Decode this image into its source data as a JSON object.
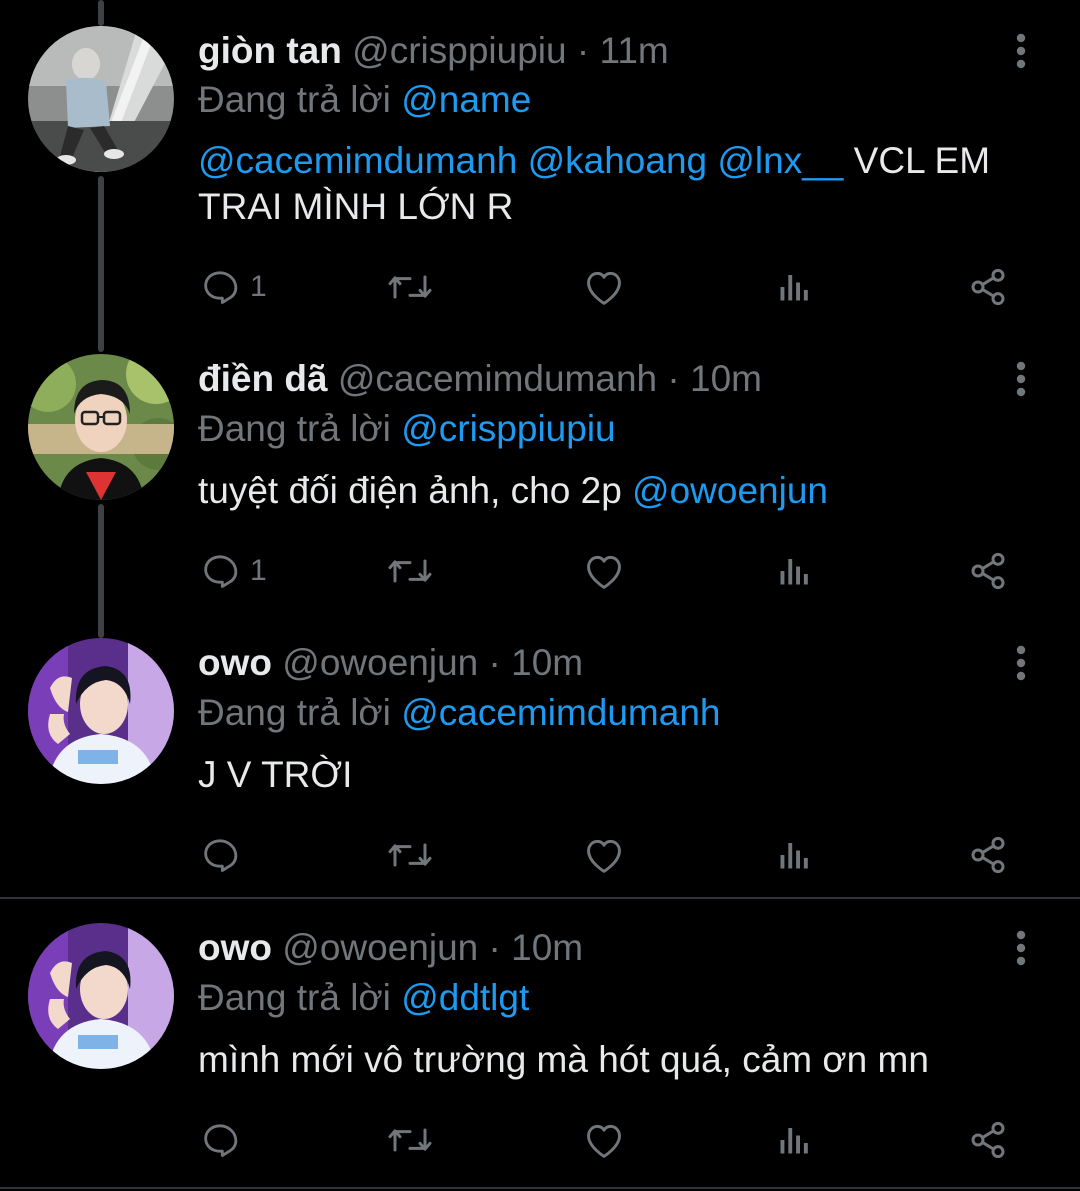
{
  "labels": {
    "replying_to": "Đang trả lời",
    "separator": "·"
  },
  "colors": {
    "background": "#000000",
    "text": "#e7e9ea",
    "secondary": "#71767b",
    "link": "#1d9bf0"
  },
  "icons": {
    "reply": "reply-icon",
    "retweet": "retweet-icon",
    "like": "heart-icon",
    "views": "views-icon",
    "share": "share-icon",
    "more": "more-vertical-icon"
  },
  "tweets": [
    {
      "name": "giòn tan",
      "handle": "@crisppiupiu",
      "time": "11m",
      "replying_to": "@name",
      "mentions": "@cacemimdumanh @kahoang @lnx__",
      "text": " VCL EM TRAI MÌNH LỚN R",
      "reply_count": "1"
    },
    {
      "name": "điền dã",
      "handle": "@cacemimdumanh",
      "time": "10m",
      "replying_to": "@crisppiupiu",
      "text": "tuyệt đối điện ảnh, cho 2p ",
      "trailing_mention": "@owoenjun",
      "reply_count": "1"
    },
    {
      "name": "owo",
      "handle": "@owoenjun",
      "time": "10m",
      "replying_to": "@cacemimdumanh",
      "text": "J V TRỜI",
      "reply_count": ""
    },
    {
      "name": "owo",
      "handle": "@owoenjun",
      "time": "10m",
      "replying_to": "@ddtlgt",
      "text": "mình mới vô trường mà hót quá, cảm ơn mn",
      "reply_count": ""
    }
  ]
}
